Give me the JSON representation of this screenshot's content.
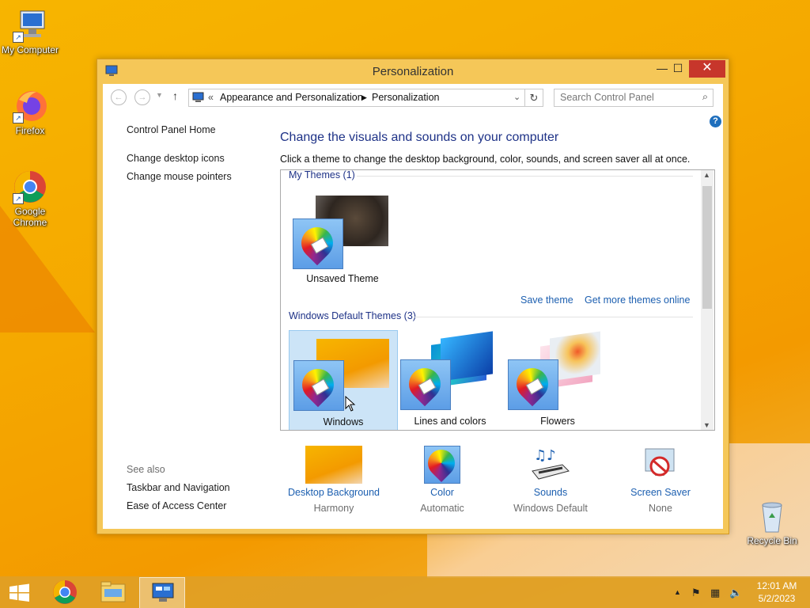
{
  "desktop": {
    "icons": [
      {
        "label": "My Computer"
      },
      {
        "label": "Firefox"
      },
      {
        "label": "Google Chrome"
      },
      {
        "label": "Recycle Bin"
      }
    ]
  },
  "window": {
    "title": "Personalization",
    "controls": {
      "minimize": "—",
      "maximize": "☐",
      "close": "✕"
    },
    "address": {
      "prefix": "«",
      "crumbs": [
        "Appearance and Personalization",
        "Personalization"
      ]
    },
    "search": {
      "placeholder": "Search Control Panel"
    },
    "left_pane": {
      "home": "Control Panel Home",
      "links": [
        "Change desktop icons",
        "Change mouse pointers"
      ],
      "see_also_title": "See also",
      "see_also": [
        "Taskbar and Navigation",
        "Ease of Access Center"
      ]
    },
    "heading": "Change the visuals and sounds on your computer",
    "subtext": "Click a theme to change the desktop background, color, sounds, and screen saver all at once.",
    "groups": {
      "my_themes": {
        "label": "My Themes (1)",
        "themes": [
          {
            "name": "Unsaved Theme"
          }
        ],
        "save_link": "Save theme",
        "more_link": "Get more themes online"
      },
      "default_themes": {
        "label": "Windows Default Themes (3)",
        "themes": [
          {
            "name": "Windows"
          },
          {
            "name": "Lines and colors"
          },
          {
            "name": "Flowers"
          }
        ]
      }
    },
    "bottom": [
      {
        "label": "Desktop Background",
        "value": "Harmony",
        "icon": "desktop-background-icon"
      },
      {
        "label": "Color",
        "value": "Automatic",
        "icon": "color-icon"
      },
      {
        "label": "Sounds",
        "value": "Windows Default",
        "icon": "sounds-icon"
      },
      {
        "label": "Screen Saver",
        "value": "None",
        "icon": "screen-saver-icon"
      }
    ],
    "help": "?"
  },
  "taskbar": {
    "clock_time": "12:01 AM",
    "clock_date": "5/2/2023"
  }
}
